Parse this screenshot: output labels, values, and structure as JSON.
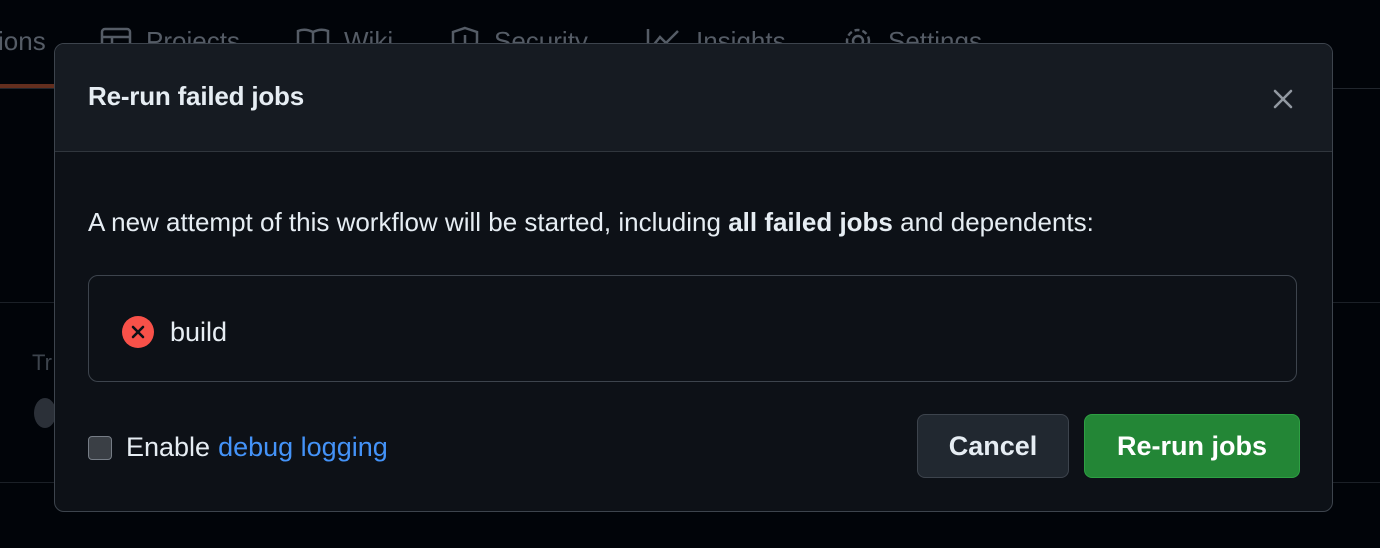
{
  "background": {
    "nav_items": [
      {
        "label": "ions",
        "icon": "none"
      },
      {
        "label": "Projects",
        "icon": "table-icon"
      },
      {
        "label": "Wiki",
        "icon": "book-icon"
      },
      {
        "label": "Security",
        "icon": "shield-icon"
      },
      {
        "label": "Insights",
        "icon": "graph-icon"
      },
      {
        "label": "Settings",
        "icon": "gear-icon"
      }
    ],
    "row_fragment": "Tr"
  },
  "modal": {
    "title": "Re-run failed jobs",
    "close_icon": "close-icon",
    "description": {
      "prefix": "A new attempt of this workflow will be started, including ",
      "emphasis": "all failed jobs",
      "suffix": " and dependents:"
    },
    "jobs": [
      {
        "name": "build",
        "status": "failed",
        "status_icon": "x-circle-fill-icon",
        "status_color": "#f85149"
      }
    ],
    "debug": {
      "checked": false,
      "label": "Enable",
      "link_text": "debug logging",
      "link_color": "#4493f8"
    },
    "buttons": {
      "cancel_label": "Cancel",
      "rerun_label": "Re-run jobs",
      "rerun_color": "#238636"
    }
  }
}
